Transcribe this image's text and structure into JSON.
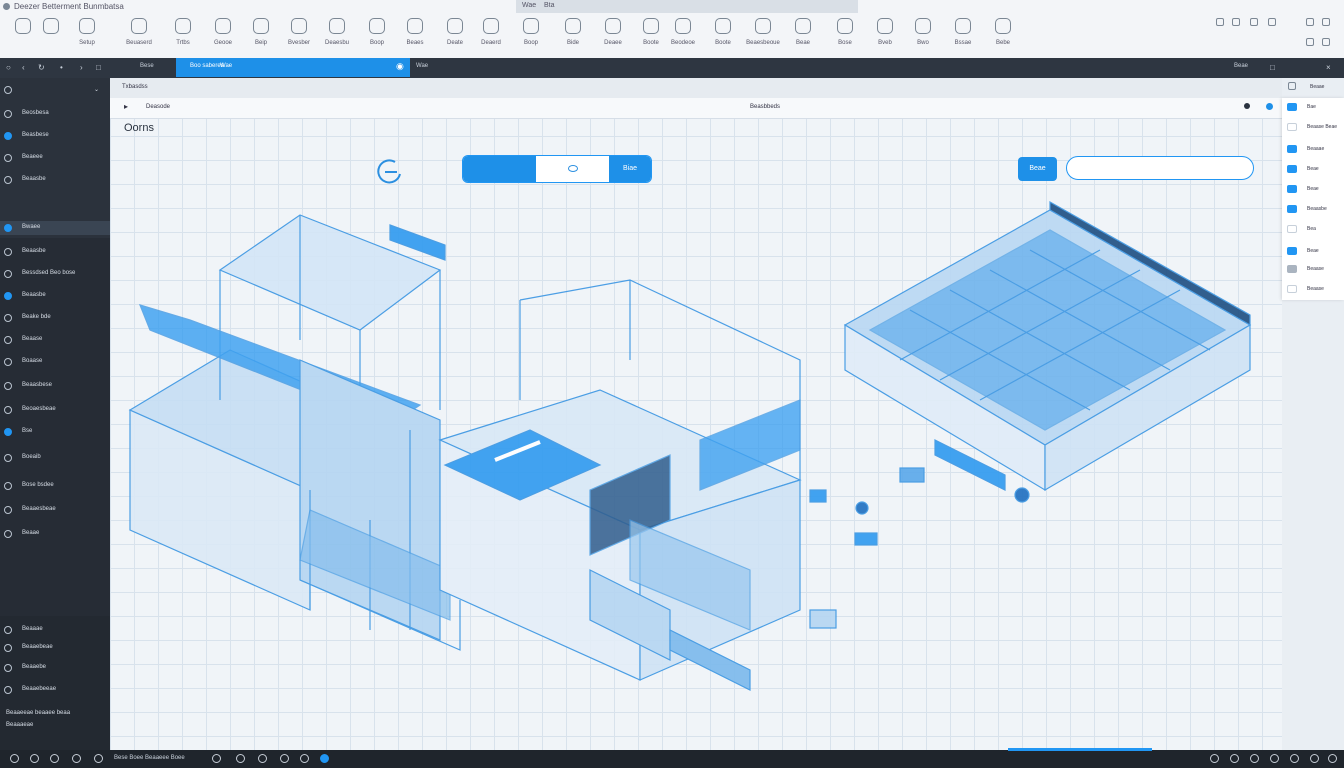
{
  "window": {
    "title": "Deezer Betterment Bunmbatsa",
    "doc_tab": {
      "label_a": "Wae",
      "label_b": "Bta"
    }
  },
  "ribbon": {
    "items": [
      {
        "label": "",
        "icon": "app-grid-icon"
      },
      {
        "label": "",
        "icon": "camera-icon"
      },
      {
        "label": "Setup",
        "icon": "layers-icon"
      },
      {
        "label": "Beuaserd",
        "icon": "globe-icon"
      },
      {
        "label": "Trtbs",
        "icon": "compass-icon"
      },
      {
        "label": "Geooe",
        "icon": "cloud-icon"
      },
      {
        "label": "Beip",
        "icon": "arrow-icon"
      },
      {
        "label": "Bvesber",
        "icon": "eye-icon"
      },
      {
        "label": "Deaesbu",
        "icon": "shield-icon"
      },
      {
        "label": "Boop",
        "icon": "circle-icon"
      },
      {
        "label": "Beaes",
        "icon": "target-icon"
      },
      {
        "label": "Deate",
        "icon": "arrow-right-icon"
      },
      {
        "label": "Deaerd",
        "icon": "menu-icon"
      },
      {
        "label": "Boop",
        "icon": "settings-icon"
      },
      {
        "label": "Bide",
        "icon": "tool-icon"
      },
      {
        "label": "Deaee",
        "icon": "lock-icon"
      },
      {
        "label": "Boote",
        "icon": "chart-icon"
      },
      {
        "label": "Beodeoe",
        "icon": "building-icon"
      },
      {
        "label": "Boote",
        "icon": "grid-icon"
      },
      {
        "label": "Beaesbeoue",
        "icon": "layers-icon"
      },
      {
        "label": "Beae",
        "icon": "stack-icon"
      },
      {
        "label": "Bose",
        "icon": "cube-icon"
      },
      {
        "label": "Bveb",
        "icon": "sun-icon"
      },
      {
        "label": "Bwo",
        "icon": "panel-icon"
      },
      {
        "label": "Bssae",
        "icon": "monitor-icon"
      },
      {
        "label": "Bebe",
        "icon": "window-icon"
      }
    ]
  },
  "toolbar": {
    "active_tab_a": "Boo saberes",
    "active_tab_b": "Wae",
    "right_tab": "Beae",
    "path_label": "Bese"
  },
  "canvas": {
    "header": "Txbasdss",
    "subheader_left": "Deasode",
    "subheader_center": "Beasbbeds",
    "title": "Oorns",
    "seg_c": "Biae",
    "go_button": "Beae",
    "search_placeholder": ""
  },
  "sidebar": {
    "top_label": "Boes",
    "items": [
      {
        "label": "Beosbesa",
        "icon": "circle-icon",
        "blue": false
      },
      {
        "label": "Beasbese",
        "icon": "globe-icon",
        "blue": true
      },
      {
        "label": "Beaeee",
        "icon": "arrow-icon",
        "blue": false
      },
      {
        "label": "Beaasbe",
        "icon": "bolt-icon",
        "blue": false
      },
      {
        "label": "Bwaee",
        "icon": "circle-icon",
        "blue": true
      },
      {
        "label": "Beaasbe",
        "icon": "circle-icon",
        "blue": false
      },
      {
        "label": "Bessdsed Beo bose",
        "icon": "circle-icon",
        "blue": false
      },
      {
        "label": "Beaasbe",
        "icon": "globe-icon",
        "blue": true
      },
      {
        "label": "Beake bde",
        "icon": "arrow-icon",
        "blue": false
      },
      {
        "label": "Beaase",
        "icon": "arrow-icon",
        "blue": false
      },
      {
        "label": "Boaase",
        "icon": "circle-icon",
        "blue": false
      },
      {
        "label": "Beaasbese",
        "icon": "arrow-icon",
        "blue": false
      },
      {
        "label": "Beoaesbeae",
        "icon": "arrow-icon",
        "blue": false
      },
      {
        "label": "Bse",
        "icon": "circle-icon",
        "blue": true
      },
      {
        "label": "Boeaib",
        "icon": "circle-icon",
        "blue": false
      },
      {
        "label": "Bose bsdee",
        "icon": "circle-icon",
        "blue": false
      },
      {
        "label": "Beaaesbeae",
        "icon": "circle-icon",
        "blue": false
      },
      {
        "label": "Beaae",
        "icon": "arrow-icon",
        "blue": false
      }
    ],
    "bottom_items": [
      {
        "label": "Beaaae",
        "icon": "arrow-icon"
      },
      {
        "label": "Beaaebeae",
        "icon": "arrow-icon"
      },
      {
        "label": "Beaaebe",
        "icon": "arrow-icon"
      },
      {
        "label": "Beaaebeeae",
        "icon": "circle-icon"
      }
    ],
    "footer_a": "Beaaeeae beaaee beaa",
    "footer_b": "Beaaaeae"
  },
  "right_panel": {
    "header": "Beaae",
    "items": [
      {
        "label": "Bae",
        "kind": "blue"
      },
      {
        "label": "Beaase Beae",
        "kind": "white"
      },
      {
        "label": "Beaaae",
        "kind": "blue"
      },
      {
        "label": "Beae",
        "kind": "blue"
      },
      {
        "label": "Beae",
        "kind": "blue"
      },
      {
        "label": "Beaasbe",
        "kind": "blue"
      },
      {
        "label": "Bea",
        "kind": "white"
      },
      {
        "label": "Beae",
        "kind": "blue"
      },
      {
        "label": "Beaase",
        "kind": "gray"
      },
      {
        "label": "Beaase",
        "kind": "white"
      }
    ]
  },
  "statusbar": {
    "text": "Bese Boee Beaaeee Boee"
  },
  "colors": {
    "accent": "#1e90e8",
    "sidebar": "#2b323c",
    "canvas_grid": "#d8e2ec",
    "blueprint": "#2b8fe0"
  }
}
